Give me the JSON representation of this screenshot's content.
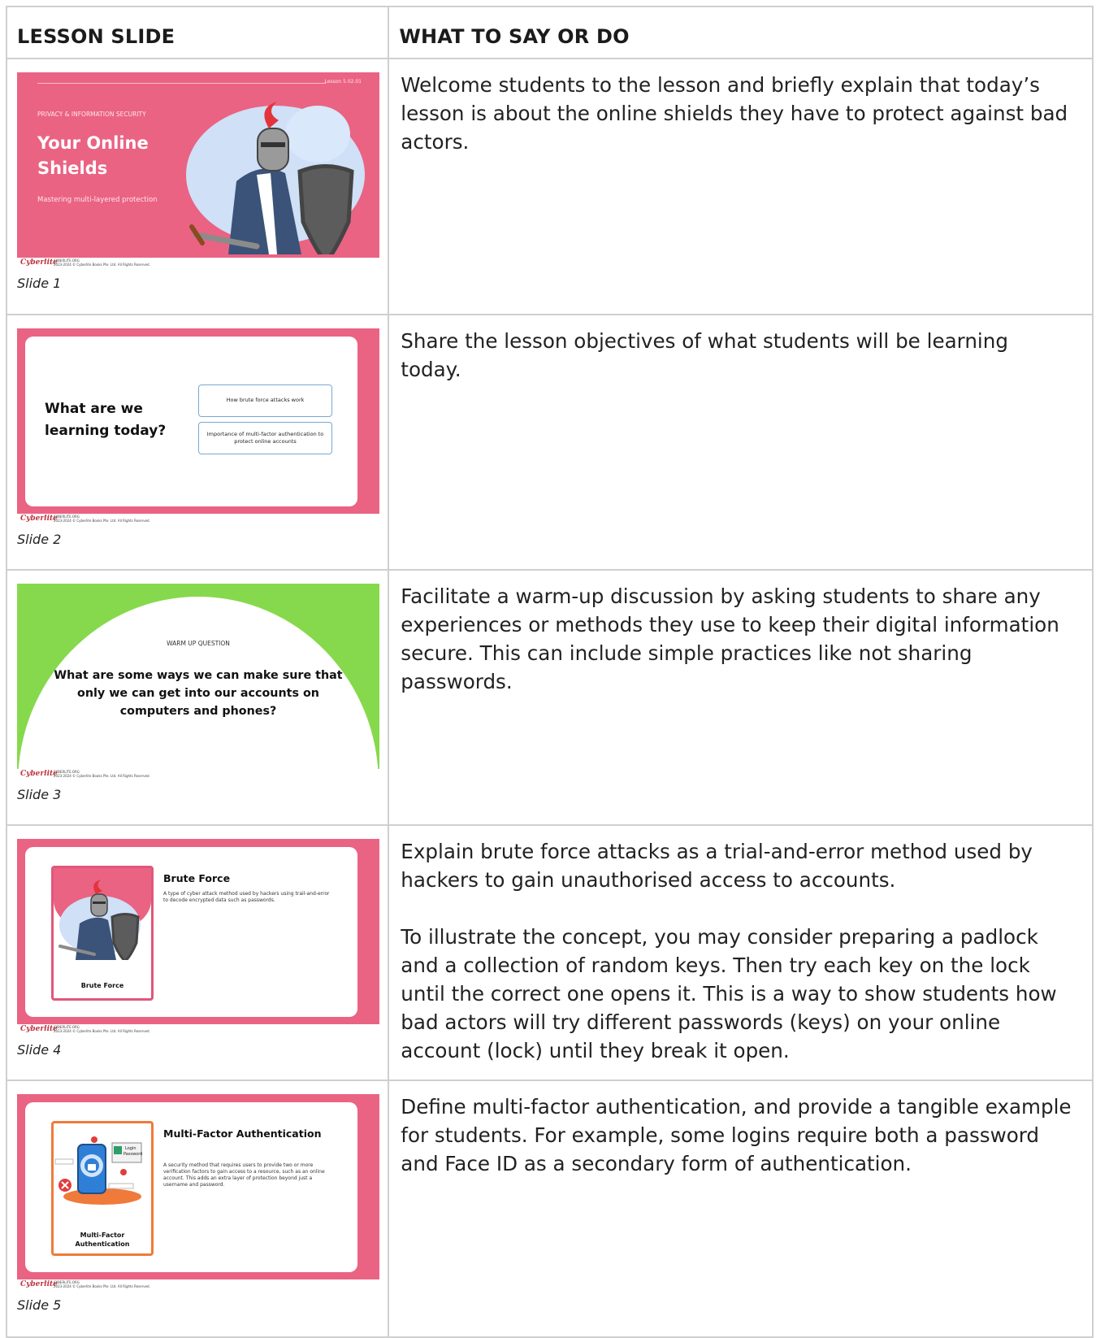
{
  "header": {
    "col1": "LESSON SLIDE",
    "col2": "WHAT TO SAY OR DO"
  },
  "footer": {
    "logo": "Cyberlite",
    "site": "CYBERLITE.ORG",
    "copyright": "2023-2024 © Cyberlite Books Pte. Ltd. All Rights Reserved."
  },
  "rows": [
    {
      "label": "Slide 1",
      "slide": {
        "lesson_no": "Lesson 5.02.01",
        "topic": "PRIVACY & INFORMATION SECURITY",
        "title": "Your Online Shields",
        "subtitle": "Mastering multi-layered protection"
      },
      "notes": [
        "Welcome students to the lesson and briefly explain that today’s lesson is about the online shields they have to protect against bad actors."
      ]
    },
    {
      "label": "Slide 2",
      "slide": {
        "question": "What are we learning today?",
        "objective_1": "How brute force attacks work",
        "objective_2": "Importance of multi-factor authentication to protect online accounts"
      },
      "notes": [
        "Share the lesson objectives of what students will be learning today."
      ]
    },
    {
      "label": "Slide 3",
      "slide": {
        "kicker": "WARM UP QUESTION",
        "question": "What are some ways we can make sure that only we can get into our accounts on computers and phones?"
      },
      "notes": [
        "Facilitate a warm-up discussion by asking students to share any experiences or methods they use to keep their digital information secure. This can include simple practices like not sharing passwords."
      ]
    },
    {
      "label": "Slide 4",
      "slide": {
        "heading": "Brute Force",
        "definition": "A type of cyber attack method used by hackers using trail-and-error to decode encrypted data such as passwords.",
        "card_label": "Brute Force"
      },
      "notes": [
        "Explain brute force attacks as a trial-and-error method used by hackers to gain unauthorised access to accounts.",
        "To illustrate the concept, you may consider preparing a padlock and a collection of random keys. Then try each key on the lock until the correct one opens it. This is a way to show students how bad actors will try different passwords (keys) on your online account (lock) until they break it open."
      ]
    },
    {
      "label": "Slide 5",
      "slide": {
        "heading": "Multi-Factor Authentication",
        "definition": "A security method that requires users to provide two or more verification factors to gain access to a resource, such as an online account. This adds an extra layer of protection beyond just a username and password.",
        "card_label": "Multi-Factor Authentication",
        "login_label": "Login",
        "password_label": "Password"
      },
      "notes": [
        "Define multi-factor authentication, and provide a tangible example for students. For example, some logins require both a password and Face ID as a secondary form of authentication."
      ]
    }
  ],
  "colors": {
    "slide_pink": "#ea6383",
    "slide_green": "#86d94c",
    "mfa_orange": "#ef7a3a",
    "table_border": "#cfcfcf"
  },
  "icons": [
    "knight-illustration",
    "shield-icon",
    "sword-icon",
    "phone-lock-illustration",
    "error-icon"
  ]
}
